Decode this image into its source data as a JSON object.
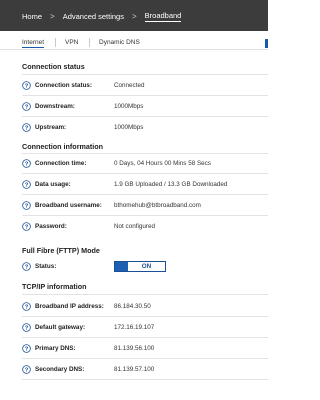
{
  "breadcrumb": {
    "items": [
      "Home",
      "Advanced settings",
      "Broadband"
    ],
    "separator": ">"
  },
  "tabs": {
    "items": [
      "Internet",
      "VPN",
      "Dynamic DNS"
    ],
    "active": "Internet"
  },
  "sections": {
    "connection_status": {
      "title": "Connection status",
      "rows": [
        {
          "label": "Connection status:",
          "value": "Connected"
        },
        {
          "label": "Downstream:",
          "value": "1000Mbps"
        },
        {
          "label": "Upstream:",
          "value": "1000Mbps"
        }
      ]
    },
    "connection_information": {
      "title": "Connection information",
      "rows": [
        {
          "label": "Connection time:",
          "value": "0 Days, 04 Hours 00 Mins 58 Secs"
        },
        {
          "label": "Data usage:",
          "value": "1.9 GB Uploaded / 13.3 GB Downloaded"
        },
        {
          "label": "Broadband username:",
          "value": "bthomehub@btbroadband.com"
        },
        {
          "label": "Password:",
          "value": "Not configured"
        }
      ]
    },
    "fttp": {
      "title": "Full Fibre (FTTP) Mode",
      "rows": [
        {
          "label": "Status:",
          "toggle": "ON"
        }
      ]
    },
    "tcpip": {
      "title": "TCP/IP information",
      "rows": [
        {
          "label": "Broadband IP address:",
          "value": "86.184.30.50"
        },
        {
          "label": "Default gateway:",
          "value": "172.16.19.107"
        },
        {
          "label": "Primary DNS:",
          "value": "81.139.56.100"
        },
        {
          "label": "Secondary DNS:",
          "value": "81.139.57.100"
        }
      ]
    }
  },
  "icons": {
    "help": "question-circle-icon"
  },
  "colors": {
    "topbar": "#3c3c3c",
    "accent": "#1a5aa8"
  }
}
